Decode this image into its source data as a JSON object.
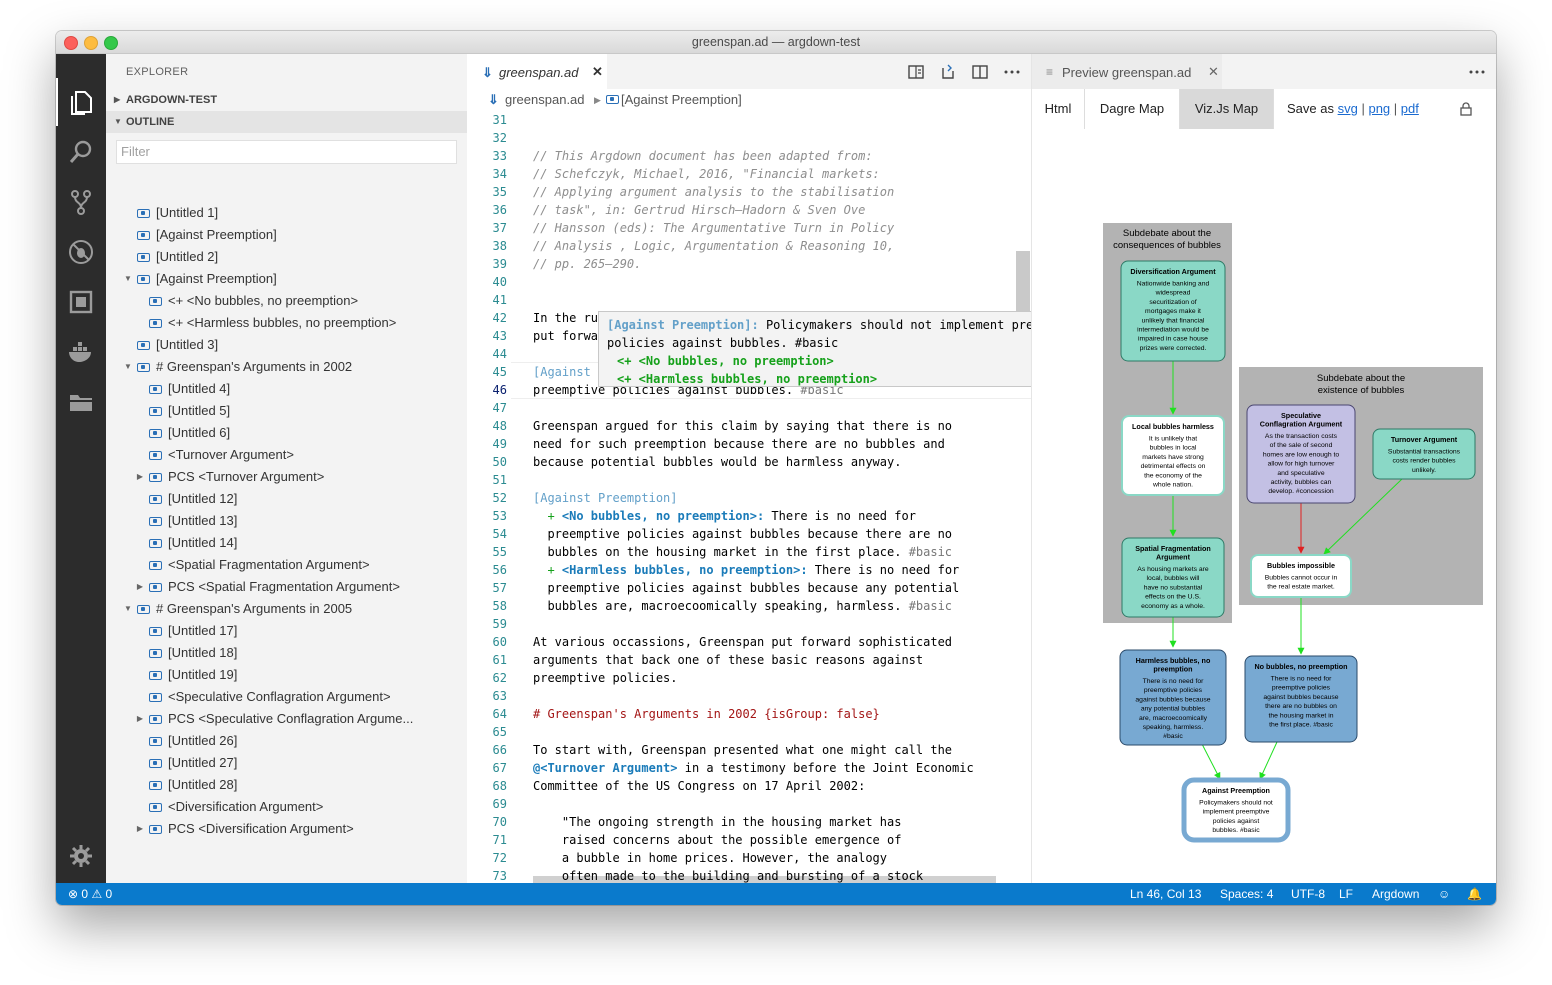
{
  "window": {
    "title": "greenspan.ad — argdown-test"
  },
  "activity_bar": {
    "icons": [
      "files-icon",
      "search-icon",
      "source-control-icon",
      "debug-icon",
      "extensions-icon",
      "docker-icon",
      "folder-icon",
      "gear-icon"
    ]
  },
  "sidebar": {
    "header": "EXPLORER",
    "sections": [
      "ARGDOWN-TEST",
      "OUTLINE"
    ],
    "filter_placeholder": "Filter",
    "outline": [
      {
        "label": "[Untitled 1]",
        "level": 0,
        "twisty": ""
      },
      {
        "label": "[Against Preemption]",
        "level": 0,
        "twisty": ""
      },
      {
        "label": "[Untitled 2]",
        "level": 0,
        "twisty": ""
      },
      {
        "label": "[Against Preemption]",
        "level": 0,
        "twisty": "open"
      },
      {
        "label": "<+ <No bubbles, no preemption>",
        "level": 1,
        "twisty": ""
      },
      {
        "label": "<+ <Harmless bubbles, no preemption>",
        "level": 1,
        "twisty": ""
      },
      {
        "label": "[Untitled 3]",
        "level": 0,
        "twisty": ""
      },
      {
        "label": "# Greenspan's Arguments in 2002",
        "level": 0,
        "twisty": "open"
      },
      {
        "label": "[Untitled 4]",
        "level": 1,
        "twisty": ""
      },
      {
        "label": "[Untitled 5]",
        "level": 1,
        "twisty": ""
      },
      {
        "label": "[Untitled 6]",
        "level": 1,
        "twisty": ""
      },
      {
        "label": "<Turnover Argument>",
        "level": 1,
        "twisty": ""
      },
      {
        "label": "PCS <Turnover Argument>",
        "level": 1,
        "twisty": "closed"
      },
      {
        "label": "[Untitled 12]",
        "level": 1,
        "twisty": ""
      },
      {
        "label": "[Untitled 13]",
        "level": 1,
        "twisty": ""
      },
      {
        "label": "[Untitled 14]",
        "level": 1,
        "twisty": ""
      },
      {
        "label": "<Spatial Fragmentation Argument>",
        "level": 1,
        "twisty": ""
      },
      {
        "label": "PCS <Spatial Fragmentation Argument>",
        "level": 1,
        "twisty": "closed"
      },
      {
        "label": "# Greenspan's Arguments in 2005",
        "level": 0,
        "twisty": "open"
      },
      {
        "label": "[Untitled 17]",
        "level": 1,
        "twisty": ""
      },
      {
        "label": "[Untitled 18]",
        "level": 1,
        "twisty": ""
      },
      {
        "label": "[Untitled 19]",
        "level": 1,
        "twisty": ""
      },
      {
        "label": "<Speculative Conflagration Argument>",
        "level": 1,
        "twisty": ""
      },
      {
        "label": "PCS <Speculative Conflagration Argume...",
        "level": 1,
        "twisty": "closed"
      },
      {
        "label": "[Untitled 26]",
        "level": 1,
        "twisty": ""
      },
      {
        "label": "[Untitled 27]",
        "level": 1,
        "twisty": ""
      },
      {
        "label": "[Untitled 28]",
        "level": 1,
        "twisty": ""
      },
      {
        "label": "<Diversification Argument>",
        "level": 1,
        "twisty": ""
      },
      {
        "label": "PCS <Diversification Argument>",
        "level": 1,
        "twisty": "closed"
      }
    ]
  },
  "editor": {
    "tab": "greenspan.ad",
    "breadcrumb": [
      "greenspan.ad",
      "[Against Preemption]"
    ],
    "cursor_line": 46,
    "lines": [
      {
        "n": "31",
        "segs": []
      },
      {
        "n": "32",
        "segs": []
      },
      {
        "n": "33",
        "cls": "comment",
        "segs": [
          {
            "t": "// This Argdown document has been adapted from:"
          }
        ]
      },
      {
        "n": "34",
        "cls": "comment",
        "segs": [
          {
            "t": "// Schefczyk, Michael, 2016, \"Financial markets:"
          }
        ]
      },
      {
        "n": "35",
        "cls": "comment",
        "segs": [
          {
            "t": "// Applying argument analysis to the stabilisation"
          }
        ]
      },
      {
        "n": "36",
        "cls": "comment",
        "segs": [
          {
            "t": "// task\", in: Gertrud Hirsch–Hadorn & Sven Ove"
          }
        ]
      },
      {
        "n": "37",
        "cls": "comment",
        "segs": [
          {
            "t": "// Hansson (eds): The Argumentative Turn in Policy"
          }
        ]
      },
      {
        "n": "38",
        "cls": "comment",
        "segs": [
          {
            "t": "// Analysis , Logic, Argumentation & Reasoning 10,"
          }
        ]
      },
      {
        "n": "39",
        "cls": "comment",
        "segs": [
          {
            "t": "// pp. 265–290."
          }
        ]
      },
      {
        "n": "40",
        "segs": []
      },
      {
        "n": "41",
        "segs": []
      },
      {
        "n": "42",
        "segs": [
          {
            "t": "In the ru"
          }
        ]
      },
      {
        "n": "43",
        "segs": [
          {
            "t": "put forwa"
          }
        ]
      },
      {
        "n": "44",
        "segs": []
      },
      {
        "n": "45",
        "segs": [
          {
            "t": "[Against Preemption]:",
            "c": "stm"
          },
          {
            "t": " Policymakers should not implement"
          }
        ]
      },
      {
        "n": "46",
        "segs": [
          {
            "t": "preemptive policies against bubbles. "
          },
          {
            "t": "#basic",
            "c": "tag"
          }
        ]
      },
      {
        "n": "47",
        "segs": []
      },
      {
        "n": "48",
        "segs": [
          {
            "t": "Greenspan argued for this claim by saying that there is no"
          }
        ]
      },
      {
        "n": "49",
        "segs": [
          {
            "t": "need for such preemption because there are no bubbles and"
          }
        ]
      },
      {
        "n": "50",
        "segs": [
          {
            "t": "because potential bubbles would be harmless anyway."
          }
        ]
      },
      {
        "n": "51",
        "segs": []
      },
      {
        "n": "52",
        "segs": [
          {
            "t": "[Against Preemption]",
            "c": "stm"
          }
        ]
      },
      {
        "n": "53",
        "segs": [
          {
            "t": "  + ",
            "c": "plus"
          },
          {
            "t": "<No bubbles, no preemption>:",
            "c": "arg"
          },
          {
            "t": " There is no need for"
          }
        ]
      },
      {
        "n": "54",
        "segs": [
          {
            "t": "  preemptive policies against bubbles because there are no"
          }
        ]
      },
      {
        "n": "55",
        "segs": [
          {
            "t": "  bubbles on the housing market in the first place. "
          },
          {
            "t": "#basic",
            "c": "tag"
          }
        ]
      },
      {
        "n": "56",
        "segs": [
          {
            "t": "  + ",
            "c": "plus"
          },
          {
            "t": "<Harmless bubbles, no preemption>:",
            "c": "arg"
          },
          {
            "t": " There is no need for"
          }
        ]
      },
      {
        "n": "57",
        "segs": [
          {
            "t": "  preemptive policies against bubbles because any potential"
          }
        ]
      },
      {
        "n": "58",
        "segs": [
          {
            "t": "  bubbles are, macroecoomically speaking, harmless. "
          },
          {
            "t": "#basic",
            "c": "tag"
          }
        ]
      },
      {
        "n": "59",
        "segs": []
      },
      {
        "n": "60",
        "segs": [
          {
            "t": "At various occassions, Greenspan put forward sophisticated"
          }
        ]
      },
      {
        "n": "61",
        "segs": [
          {
            "t": "arguments that back one of these basic reasons against"
          }
        ]
      },
      {
        "n": "62",
        "segs": [
          {
            "t": "preemptive policies."
          }
        ]
      },
      {
        "n": "63",
        "segs": []
      },
      {
        "n": "64",
        "cls": "heading",
        "segs": [
          {
            "t": "# Greenspan's Arguments in 2002 {isGroup: false}"
          }
        ]
      },
      {
        "n": "65",
        "segs": []
      },
      {
        "n": "66",
        "segs": [
          {
            "t": "To start with, Greenspan presented what one might call the"
          }
        ]
      },
      {
        "n": "67",
        "segs": [
          {
            "t": "@<Turnover Argument>",
            "c": "arg"
          },
          {
            "t": " in a testimony before the Joint Economic"
          }
        ]
      },
      {
        "n": "68",
        "segs": [
          {
            "t": "Committee of the US Congress on 17 April 2002:"
          }
        ]
      },
      {
        "n": "69",
        "segs": []
      },
      {
        "n": "70",
        "segs": [
          {
            "t": "    \"The ongoing strength in the housing market has"
          }
        ]
      },
      {
        "n": "71",
        "segs": [
          {
            "t": "    raised concerns about the possible emergence of"
          }
        ]
      },
      {
        "n": "72",
        "segs": [
          {
            "t": "    a bubble in home prices. However, the analogy"
          }
        ]
      },
      {
        "n": "73",
        "segs": [
          {
            "t": "    often made to the building and bursting of a stock"
          }
        ]
      }
    ],
    "hover": {
      "line1_stm": "[Against Preemption]:",
      "line1_rest": " Policymakers should not implement preemptive",
      "line2": "policies against bubbles. #basic",
      "line3": "<+ <No bubbles, no preemption>",
      "line4": "<+ <Harmless bubbles, no preemption>"
    }
  },
  "preview": {
    "tab": "Preview greenspan.ad",
    "nav": {
      "html": "Html",
      "dagre": "Dagre Map",
      "viz": "Viz.Js Map",
      "save_as": "Save as",
      "svg": "svg",
      "png": "png",
      "pdf": "pdf"
    },
    "map": {
      "groups": [
        {
          "title1": "Subdebate about the",
          "title2": "consequences of bubbles"
        },
        {
          "title1": "Subdebate about the",
          "title2": "existence of bubbles"
        }
      ],
      "nodes": {
        "diversification": {
          "title": "Diversification Argument",
          "body": [
            "Nationwide banking and",
            "widespread",
            "securitization of",
            "mortgages make it",
            "unlikely that financial",
            "intermediation would be",
            "impaired in case house",
            "prizes were corrected."
          ]
        },
        "local": {
          "title": "Local bubbles harmless",
          "body": [
            "It is unlikely that",
            "bubbles in local",
            "markets have strong",
            "detrimental effects on",
            "the economy of the",
            "whole nation."
          ]
        },
        "spatial": {
          "title": "Spatial Fragmentation",
          "title2": "Argument",
          "body": [
            "As housing markets are",
            "local, bubbles will",
            "have no substantial",
            "effects on the U.S.",
            "economy as a whole."
          ]
        },
        "speculative": {
          "title": "Speculative",
          "title2": "Conflagration Argument",
          "body": [
            "As the transaction costs",
            "of the sale of second",
            "homes are low enough to",
            "allow for high turnover",
            "and speculative",
            "activity, bubbles can",
            "develop. #concession"
          ]
        },
        "turnover": {
          "title": "Turnover Argument",
          "body": [
            "Substantial transactions",
            "costs render bubbles",
            "unlikely."
          ]
        },
        "impossible": {
          "title": "Bubbles impossible",
          "body": [
            "Bubbles cannot occur in",
            "the real estate market."
          ]
        },
        "harmless": {
          "title": "Harmless bubbles, no",
          "title2": "preemption",
          "body": [
            "There is no need for",
            "preemptive policies",
            "against bubbles because",
            "any potential bubbles",
            "are, macroecoomically",
            "speaking, harmless.",
            "#basic"
          ]
        },
        "nobubbles": {
          "title": "No bubbles, no preemption",
          "body": [
            "There is no need for",
            "preemptive policies",
            "against bubbles because",
            "there are no bubbles on",
            "the housing market in",
            "the first place. #basic"
          ]
        },
        "against": {
          "title": "Against Preemption",
          "body": [
            "Policymakers should not",
            "implement preemptive",
            "policies against",
            "bubbles. #basic"
          ]
        }
      }
    }
  },
  "status": {
    "errors": "0",
    "warnings": "0",
    "position": "Ln 46, Col 13",
    "spaces": "Spaces: 4",
    "encoding": "UTF-8",
    "eol": "LF",
    "language": "Argdown"
  },
  "colors": {
    "accent": "#0a7acc",
    "support": "#20e020",
    "attack": "#e02020",
    "argument_teal": "#8ad8c6",
    "argument_blue": "#78a9d2",
    "argument_purple": "#c3c0e4"
  }
}
